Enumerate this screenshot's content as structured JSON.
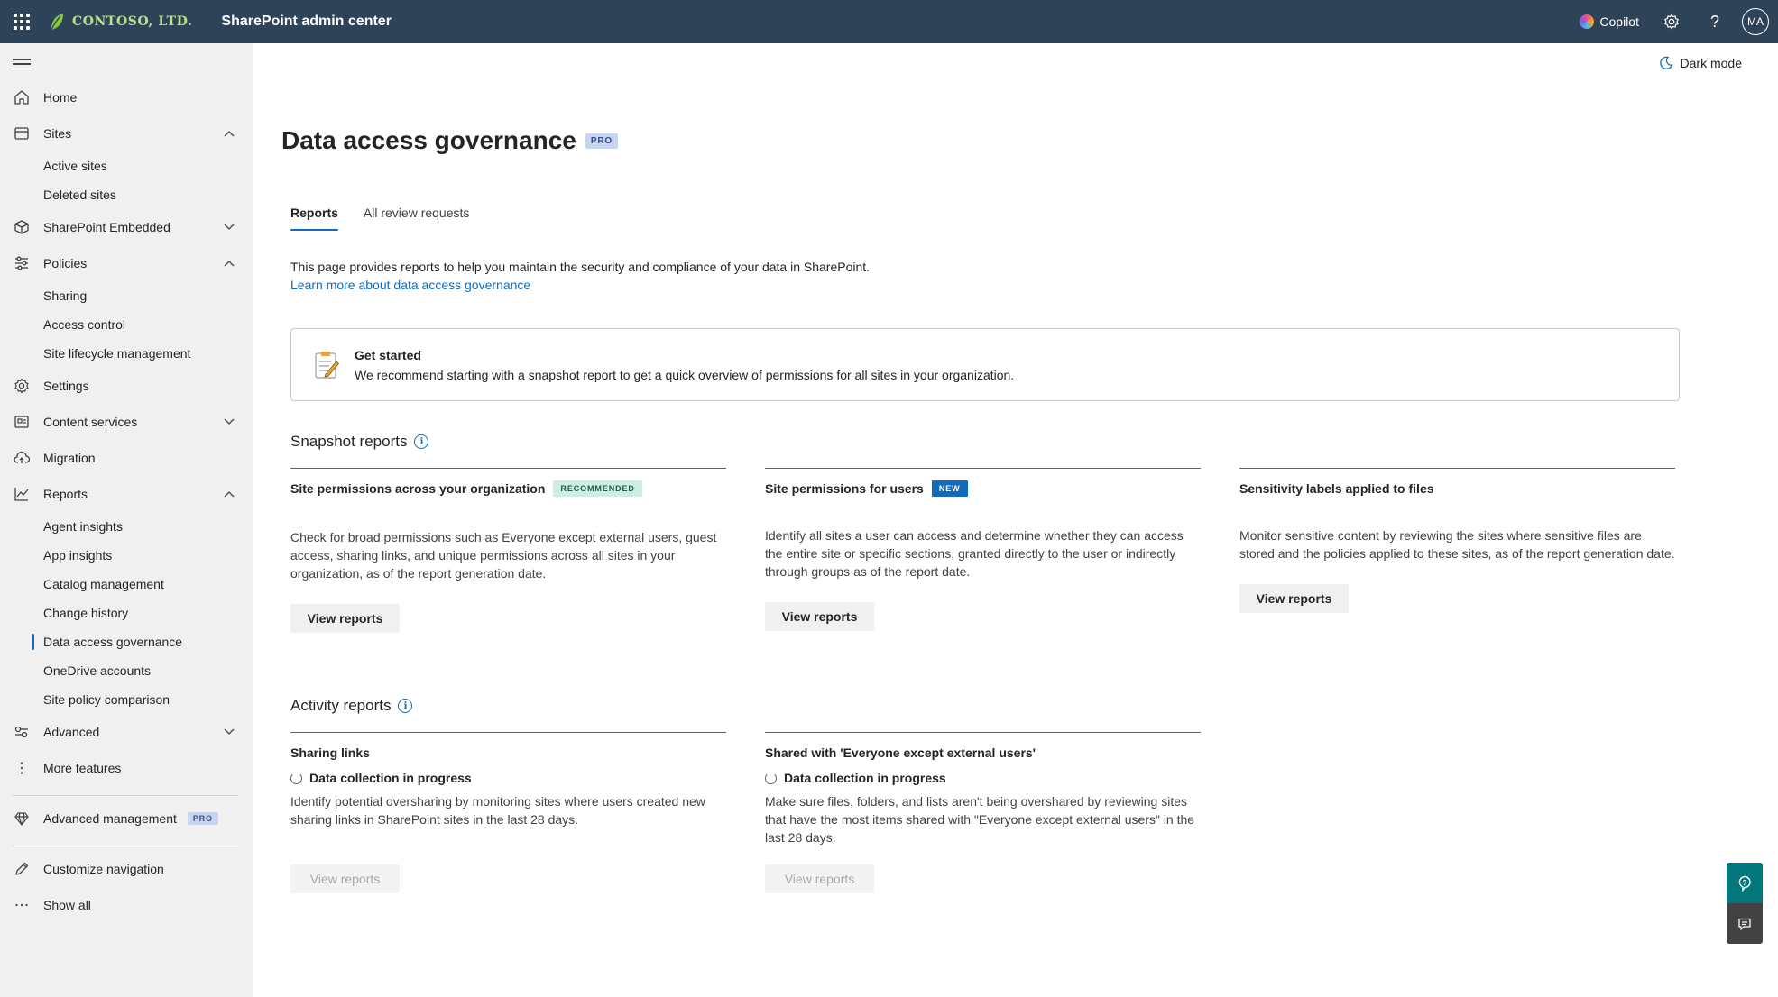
{
  "topbar": {
    "brand": "CONTOSO, LTD.",
    "app_title": "SharePoint admin center",
    "copilot_label": "Copilot",
    "avatar_initials": "MA"
  },
  "sidebar": {
    "home": "Home",
    "sites": "Sites",
    "active_sites": "Active sites",
    "deleted_sites": "Deleted sites",
    "sharepoint_embedded": "SharePoint Embedded",
    "policies": "Policies",
    "sharing": "Sharing",
    "access_control": "Access control",
    "site_lifecycle": "Site lifecycle management",
    "settings": "Settings",
    "content_services": "Content services",
    "migration": "Migration",
    "reports": "Reports",
    "agent_insights": "Agent insights",
    "app_insights": "App insights",
    "catalog_management": "Catalog management",
    "change_history": "Change history",
    "data_access_governance": "Data access governance",
    "onedrive_accounts": "OneDrive accounts",
    "site_policy_comparison": "Site policy comparison",
    "advanced": "Advanced",
    "more_features": "More features",
    "advanced_management": "Advanced management",
    "pro_badge": "PRO",
    "customize_navigation": "Customize navigation",
    "show_all": "Show all"
  },
  "main": {
    "dark_mode": "Dark mode",
    "page_title": "Data access governance",
    "page_badge": "PRO",
    "tabs": [
      "Reports",
      "All review requests"
    ],
    "description": "This page provides reports to help you maintain the security and compliance of your data in SharePoint.",
    "learn_more": "Learn more about data access governance",
    "get_started_title": "Get started",
    "get_started_text": "We recommend starting with a snapshot report to get a quick overview of permissions for all sites in your organization.",
    "snapshot_title": "Snapshot reports",
    "activity_title": "Activity reports",
    "snapshot_cards": [
      {
        "title": "Site permissions across your organization",
        "tag": "RECOMMENDED",
        "text": "Check for broad permissions such as Everyone except external users, guest access, sharing links, and unique permissions across all sites in your organization, as of the report generation date.",
        "button": "View reports"
      },
      {
        "title": "Site permissions for users",
        "tag": "NEW",
        "text": "Identify all sites a user can access and determine whether they can access the entire site or specific sections, granted directly to the user or indirectly through groups as of the report date.",
        "button": "View reports"
      },
      {
        "title": "Sensitivity labels applied to files",
        "text": "Monitor sensitive content by reviewing the sites where sensitive files are stored and the policies applied to these sites, as of the report generation date.",
        "button": "View reports"
      }
    ],
    "activity_cards": [
      {
        "title": "Sharing links",
        "status": "Data collection in progress",
        "text": "Identify potential oversharing by monitoring sites where users created new sharing links in SharePoint sites in the last 28 days.",
        "button": "View reports"
      },
      {
        "title": "Shared with 'Everyone except external users'",
        "status": "Data collection in progress",
        "text": "Make sure files, folders, and lists aren't being overshared by reviewing sites that have the most items shared with \"Everyone except external users\" in the last 28 days.",
        "button": "View reports"
      }
    ]
  }
}
